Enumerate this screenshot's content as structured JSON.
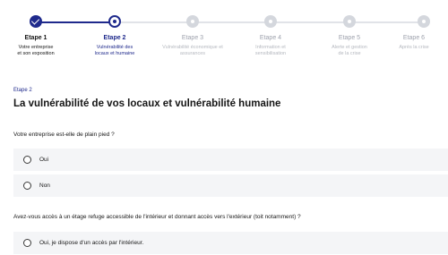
{
  "stepper": {
    "steps": [
      {
        "title": "Etape 1",
        "desc_line1": "Votre entreprise",
        "desc_line2": "et son exposition",
        "state": "done"
      },
      {
        "title": "Etape 2",
        "desc_line1": "Vulnérabilité des",
        "desc_line2": "locaux et humaine",
        "state": "current"
      },
      {
        "title": "Etape 3",
        "desc_line1": "Vulnérabilité économique et",
        "desc_line2": "assurances",
        "state": "todo"
      },
      {
        "title": "Etape 4",
        "desc_line1": "Information et",
        "desc_line2": "sensibilisation",
        "state": "todo"
      },
      {
        "title": "Etape 5",
        "desc_line1": "Alerte et gestion",
        "desc_line2": "de la crise",
        "state": "todo"
      },
      {
        "title": "Etape 6",
        "desc_line1": "Après la crise",
        "desc_line2": "",
        "state": "todo"
      }
    ]
  },
  "main": {
    "eyebrow": "Etape 2",
    "title": "La vulnérabilité de vos locaux et vulnérabilité humaine",
    "question1": {
      "label": "Votre entreprise est-elle de plain pied ?",
      "options": [
        "Oui",
        "Non"
      ]
    },
    "question2": {
      "label": "Avez-vous accès à un étage refuge accessible de l'intérieur et donnant accès vers l'extérieur (toit notamment) ?",
      "options": [
        "Oui, je dispose d'un accès par l'intérieur."
      ]
    }
  },
  "colors": {
    "accent": "#1f2a8c",
    "inactive_step": "#d4d7dd",
    "option_background": "#f4f5f7"
  }
}
